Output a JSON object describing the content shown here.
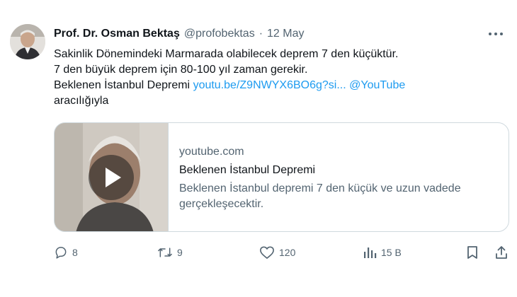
{
  "author": {
    "name": "Prof. Dr. Osman Bektaş",
    "handle": "@profobektas",
    "separator": "·",
    "date": "12 May"
  },
  "tweet": {
    "lines": [
      "Sakinlik Dönemindeki Marmarada olabilecek deprem 7 den küçüktür.",
      "7 den büyük deprem için 80-100 yıl zaman gerekir."
    ],
    "line3_text": "Beklenen İstanbul Depremi",
    "link_url": "youtu.be/Z9NWYX6BO6g?si...",
    "mention": "@YouTube",
    "line4_text": "aracılığıyla"
  },
  "card": {
    "domain": "youtube.com",
    "title": "Beklenen İstanbul Depremi",
    "description": "Beklenen İstanbul depremi 7 den küçük ve uzun vadede gerçekleşecektir."
  },
  "actions": {
    "replies": "8",
    "retweets": "9",
    "likes": "120",
    "views": "15 B"
  },
  "colors": {
    "accent": "#1d9bf0",
    "text": "#0f1419",
    "secondary": "#536471",
    "border": "#cfd9de"
  },
  "icons": [
    "more-icon",
    "reply-icon",
    "retweet-icon",
    "like-icon",
    "views-icon",
    "bookmark-icon",
    "share-icon",
    "play-icon"
  ]
}
